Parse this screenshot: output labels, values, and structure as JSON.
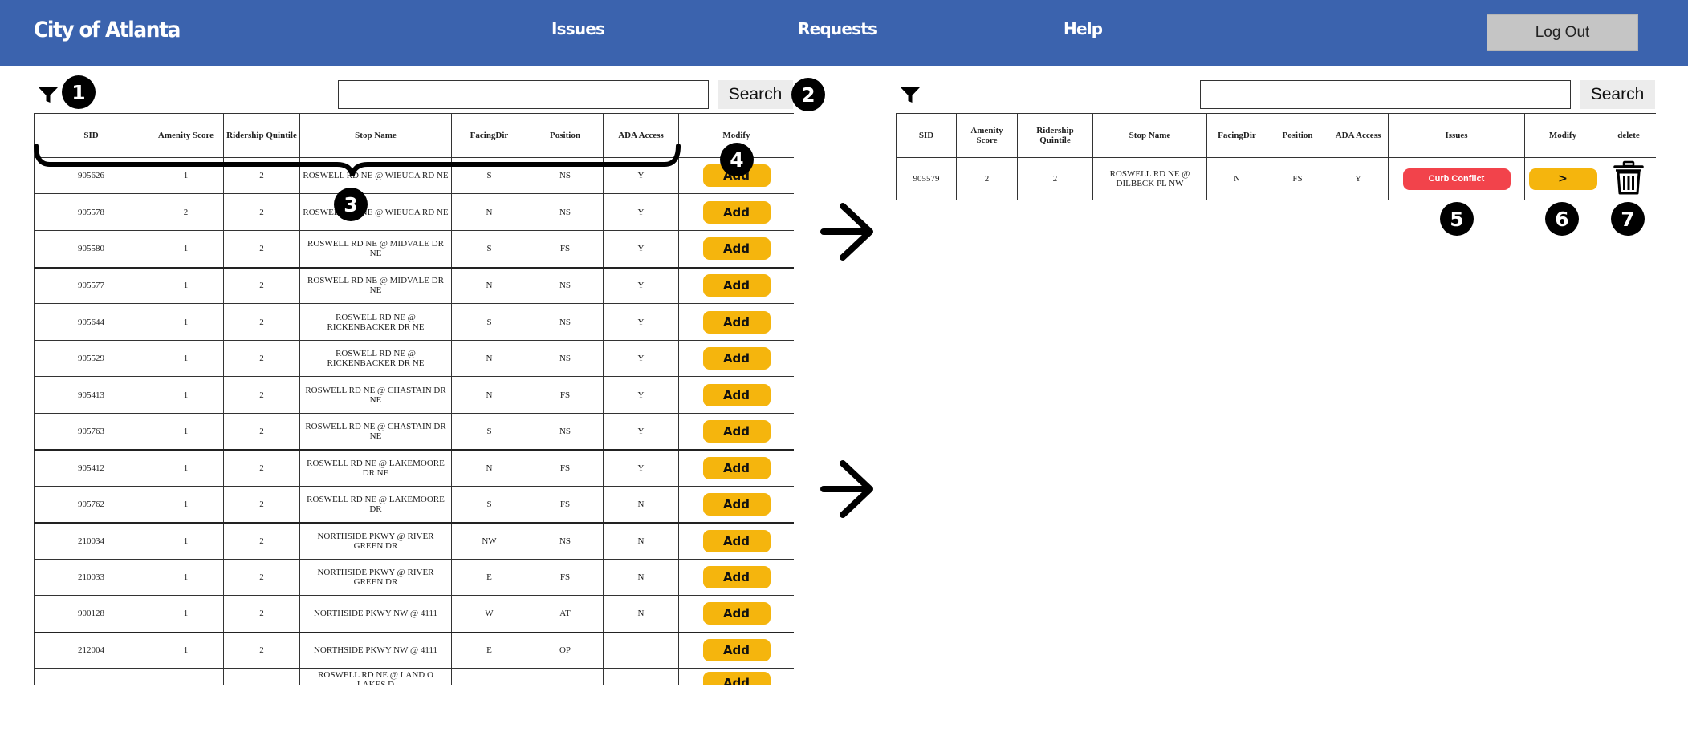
{
  "header": {
    "brand": "City of Atlanta",
    "nav": [
      "Issues",
      "Requests",
      "Help"
    ],
    "logout_label": "Log Out",
    "bg_color": "#3b63ae"
  },
  "left_panel": {
    "filter_icon": "filter-icon",
    "search_placeholder": "",
    "search_label": "Search",
    "columns": [
      "SID",
      "Amenity Score",
      "Ridership Quintile",
      "Stop Name",
      "FacingDir",
      "Position",
      "ADA Access",
      "Modify"
    ],
    "add_label": "Add",
    "rows": [
      [
        "905626",
        "1",
        "2",
        "ROSWELL RD NE @ WIEUCA RD NE",
        "S",
        "NS",
        "Y"
      ],
      [
        "905578",
        "2",
        "2",
        "ROSWELL RD NE @ WIEUCA RD NE",
        "N",
        "NS",
        "Y"
      ],
      [
        "905580",
        "1",
        "2",
        "ROSWELL RD NE @ MIDVALE DR NE",
        "S",
        "FS",
        "Y"
      ],
      [
        "905577",
        "1",
        "2",
        "ROSWELL RD NE @ MIDVALE DR NE",
        "N",
        "NS",
        "Y"
      ],
      [
        "905644",
        "1",
        "2",
        "ROSWELL RD NE @ RICKENBACKER DR NE",
        "S",
        "NS",
        "Y"
      ],
      [
        "905529",
        "1",
        "2",
        "ROSWELL RD NE @ RICKENBACKER DR NE",
        "N",
        "NS",
        "Y"
      ],
      [
        "905413",
        "1",
        "2",
        "ROSWELL RD NE @ CHASTAIN DR NE",
        "N",
        "FS",
        "Y"
      ],
      [
        "905763",
        "1",
        "2",
        "ROSWELL RD NE @ CHASTAIN DR NE",
        "S",
        "NS",
        "Y"
      ],
      [
        "905412",
        "1",
        "2",
        "ROSWELL RD NE @ LAKEMOORE DR NE",
        "N",
        "FS",
        "Y"
      ],
      [
        "905762",
        "1",
        "2",
        "ROSWELL RD NE @ LAKEMOORE DR",
        "S",
        "FS",
        "N"
      ],
      [
        "210034",
        "1",
        "2",
        "NORTHSIDE PKWY @ RIVER GREEN DR",
        "NW",
        "NS",
        "N"
      ],
      [
        "210033",
        "1",
        "2",
        "NORTHSIDE PKWY @ RIVER GREEN DR",
        "E",
        "FS",
        "N"
      ],
      [
        "900128",
        "1",
        "2",
        "NORTHSIDE PKWY NW @ 4111",
        "W",
        "AT",
        "N"
      ],
      [
        "212004",
        "1",
        "2",
        "NORTHSIDE PKWY NW @ 4111",
        "E",
        "OP",
        ""
      ],
      [
        "",
        "",
        "",
        "ROSWELL RD NE @ LAND O LAKES D",
        "",
        "",
        ""
      ]
    ]
  },
  "right_panel": {
    "filter_icon": "filter-icon",
    "search_placeholder": "",
    "search_label": "Search",
    "columns": [
      "SID",
      "Amenity Score",
      "Ridership Quintile",
      "Stop Name",
      "FacingDir",
      "Position",
      "ADA Access",
      "Issues",
      "Modify",
      "delete"
    ],
    "row": {
      "sid": "905579",
      "amenity": "2",
      "ridership": "2",
      "stop_name": "ROSWELL RD NE @ DILBECK PL NW",
      "facing": "N",
      "position": "FS",
      "ada": "Y",
      "issue": "Curb Conflict",
      "modify": ">",
      "delete_icon": "trash-icon"
    }
  },
  "callouts": [
    "1",
    "2",
    "3",
    "4",
    "5",
    "6",
    "7"
  ],
  "colors": {
    "accent_yellow": "#f5b50d",
    "issue_red": "#f2434b",
    "header_blue": "#3b63ae"
  }
}
